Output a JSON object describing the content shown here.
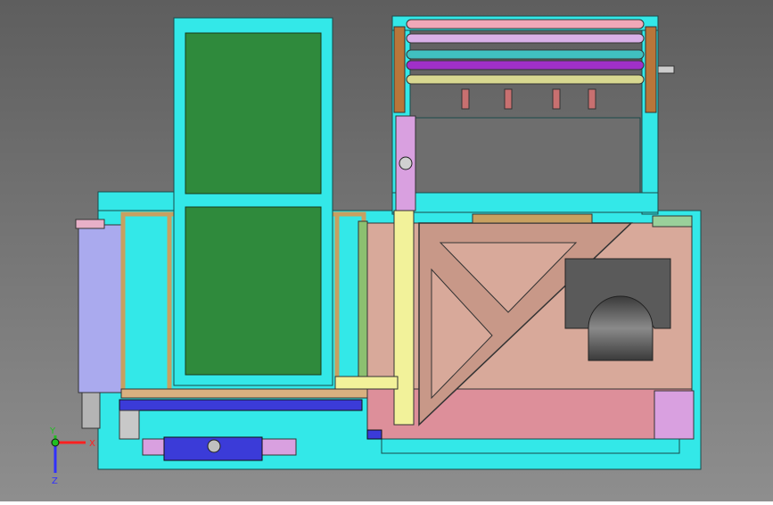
{
  "viewport": {
    "background_top": "#5e5e5e",
    "background_bottom": "#8e8e8e"
  },
  "axis_triad": {
    "x_label": "X",
    "y_label": "Y",
    "z_label": "Z",
    "x_color": "#ff2020",
    "y_color": "#20c020",
    "z_color": "#3030ff"
  },
  "colors": {
    "frame": "#33e8e8",
    "panel": "#2f8a3c",
    "plate": "#d8a99a",
    "lower_plate": "#dd8f9a",
    "side_box": "#aaaaee",
    "yellow_rail": "#f2f29a",
    "lilac": "#d9a0e0",
    "blue_bar": "#3b3bd8",
    "tan": "#c8a060",
    "dark_cut": "#5a5a5a"
  },
  "rollers": [
    {
      "name": "pink",
      "color": "#f0a8b8"
    },
    {
      "name": "lavender",
      "color": "#d9b0e8"
    },
    {
      "name": "teal",
      "color": "#40c0c0"
    },
    {
      "name": "violet",
      "color": "#a030c8"
    },
    {
      "name": "olive",
      "color": "#d8d890"
    }
  ]
}
